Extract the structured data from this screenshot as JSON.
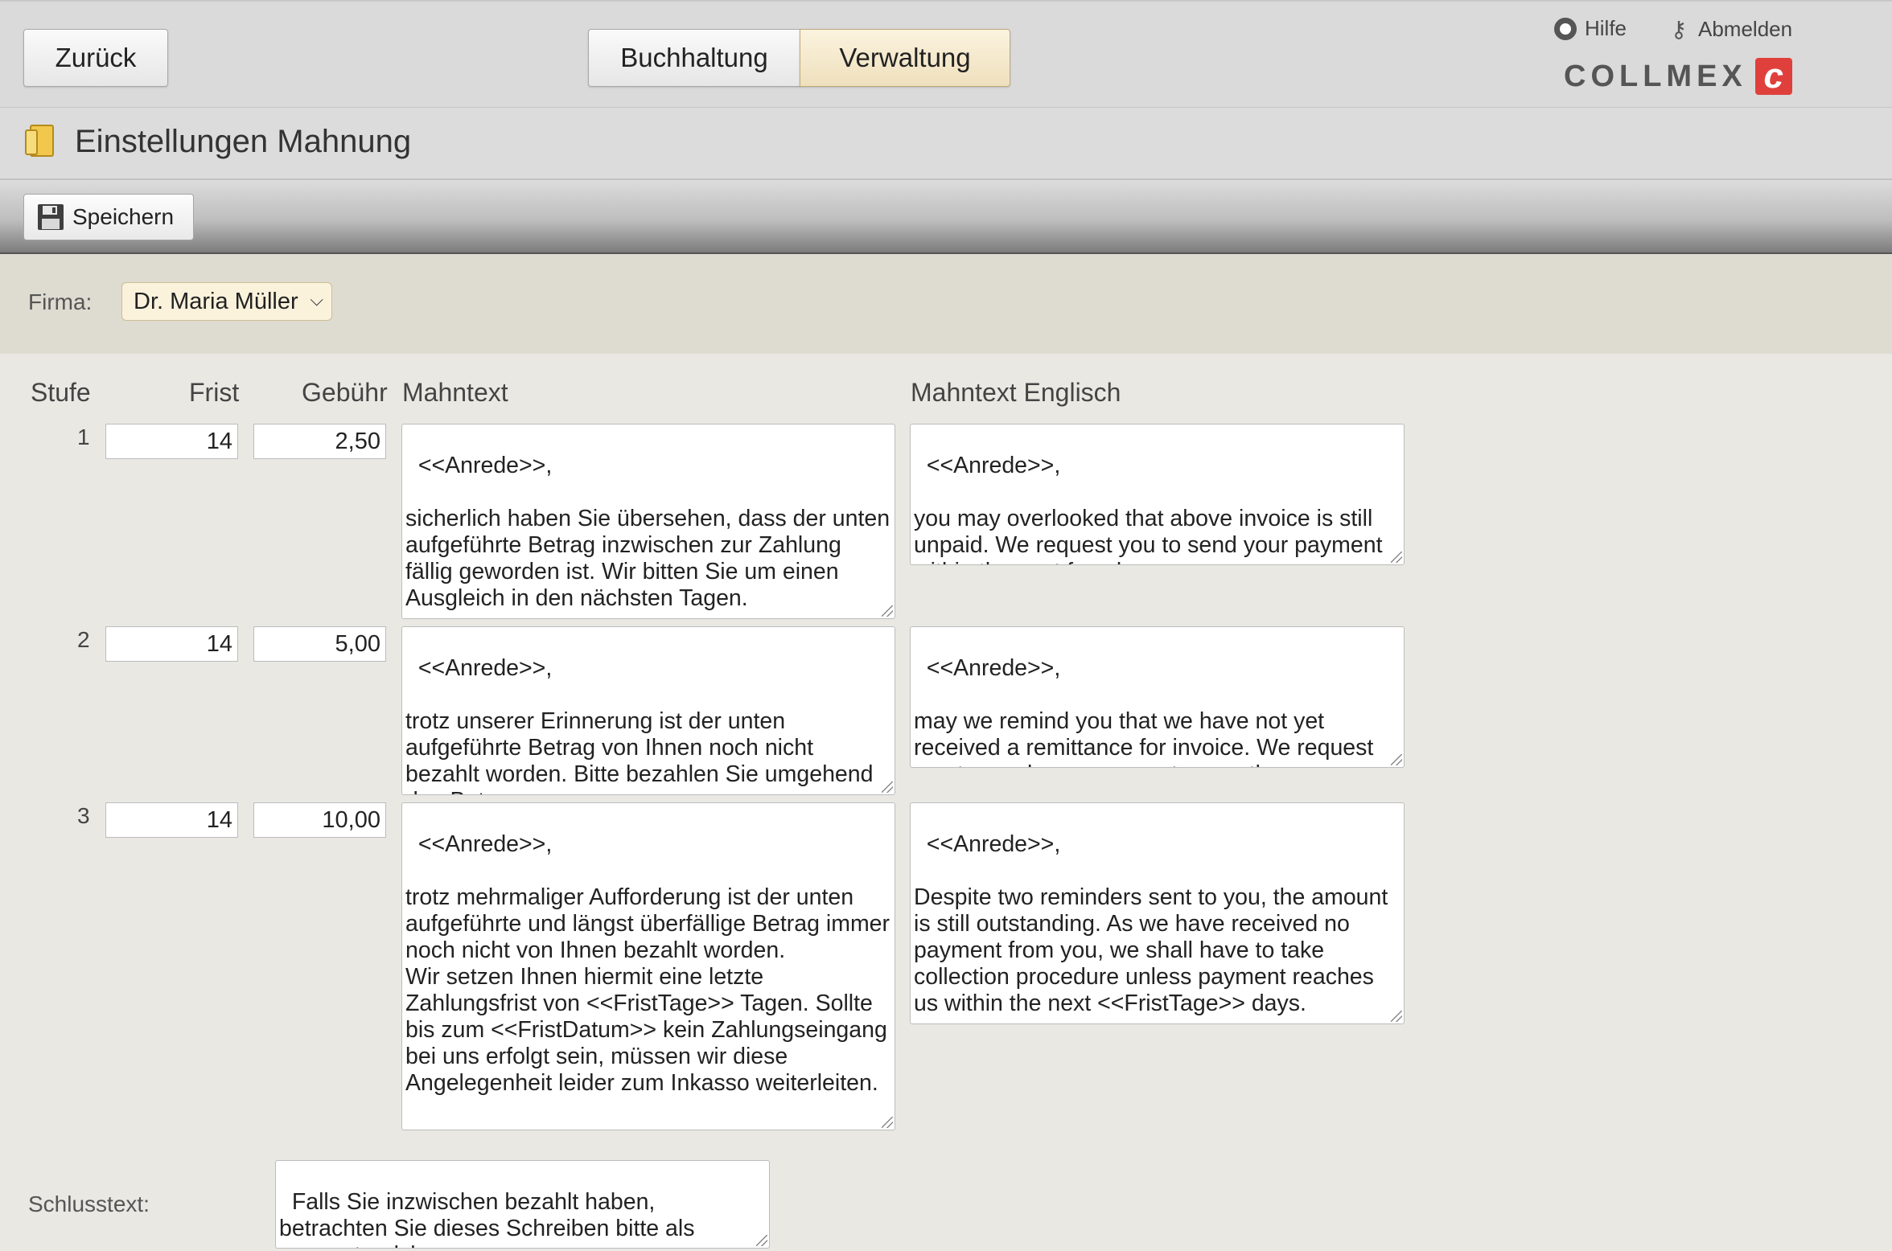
{
  "header": {
    "back_label": "Zurück",
    "tabs": [
      {
        "label": "Buchhaltung",
        "active": false
      },
      {
        "label": "Verwaltung",
        "active": true
      }
    ],
    "help_label": "Hilfe",
    "logout_label": "Abmelden",
    "logo_text": "COLLMEX"
  },
  "page": {
    "title": "Einstellungen Mahnung",
    "save_label": "Speichern"
  },
  "firma": {
    "label": "Firma:",
    "selected": "Dr. Maria Müller"
  },
  "table": {
    "headers": {
      "stufe": "Stufe",
      "frist": "Frist",
      "gebuehr": "Gebühr",
      "mahntext": "Mahntext",
      "mahntext_en": "Mahntext Englisch"
    },
    "rows": [
      {
        "stufe": "1",
        "frist": "14",
        "gebuehr": "2,50",
        "mahntext": "<<Anrede>>,\n\nsicherlich haben Sie übersehen, dass der unten aufgeführte Betrag inzwischen zur Zahlung fällig geworden ist. Wir bitten Sie um einen Ausgleich in den nächsten Tagen.",
        "mahntext_en": "<<Anrede>>,\n\nyou may overlooked that above invoice is still unpaid. We request you to send your payment within the next few days."
      },
      {
        "stufe": "2",
        "frist": "14",
        "gebuehr": "5,00",
        "mahntext": "<<Anrede>>,\n\ntrotz unserer Erinnerung ist der unten aufgeführte Betrag von Ihnen noch nicht bezahlt worden. Bitte bezahlen Sie umgehend den Betrag.",
        "mahntext_en": "<<Anrede>>,\n\nmay we remind you that we have not yet received a remittance for invoice. We request you to send your payment promptly."
      },
      {
        "stufe": "3",
        "frist": "14",
        "gebuehr": "10,00",
        "mahntext": "<<Anrede>>,\n\ntrotz mehrmaliger Aufforderung ist der unten aufgeführte und längst überfällige Betrag immer noch nicht von Ihnen bezahlt worden.\nWir setzen Ihnen hiermit eine letzte Zahlungsfrist von <<FristTage>> Tagen. Sollte bis zum <<FristDatum>> kein Zahlungseingang bei uns erfolgt sein, müssen wir diese Angelegenheit leider zum Inkasso weiterleiten.",
        "mahntext_en": "<<Anrede>>,\n\nDespite two reminders sent to you, the amount is still outstanding. As we have received no payment from you, we shall have to take collection procedure unless payment reaches us within the next <<FristTage>> days."
      }
    ]
  },
  "schlusstext": {
    "label": "Schlusstext:",
    "value": "Falls Sie inzwischen bezahlt haben, betrachten Sie dieses Schreiben bitte als gegenstandslos."
  },
  "colors": {
    "active_tab": "#f3e6c6",
    "logo_red": "#e0403c",
    "firma_bg": "#dedbd1",
    "content_bg": "#e9e8e3"
  },
  "icons": {
    "help": "help-lifebuoy-icon",
    "logout": "key-icon",
    "save": "floppy-disk-icon",
    "page": "folder-icon",
    "dropdown": "chevron-down-icon"
  }
}
